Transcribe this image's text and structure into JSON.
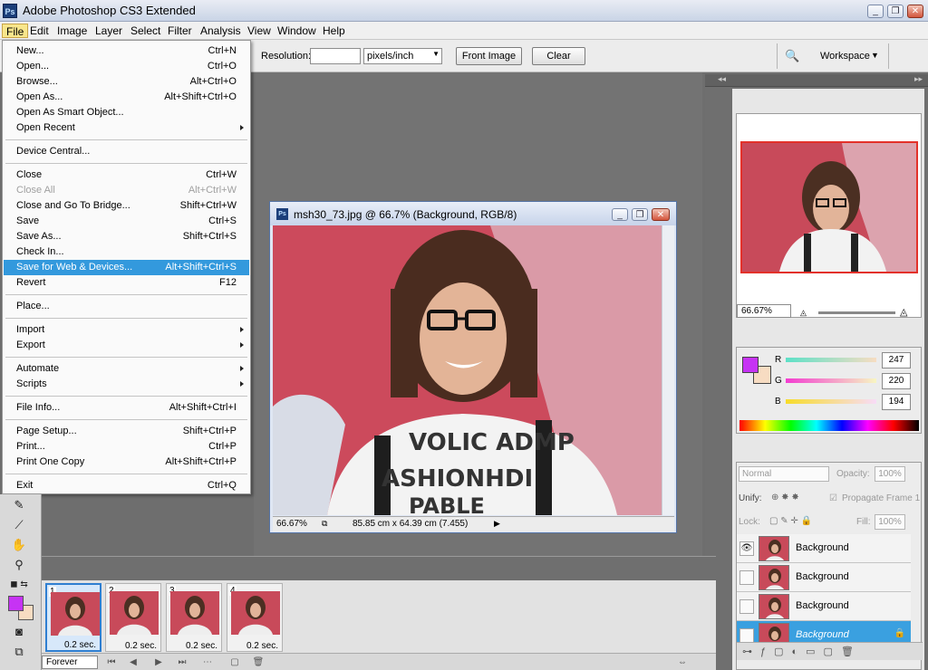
{
  "app": {
    "title": "Adobe Photoshop CS3 Extended",
    "logo": "Ps",
    "window_controls": {
      "minimize": "_",
      "restore": "❐",
      "close": "✕"
    }
  },
  "menubar": [
    "File",
    "Edit",
    "Image",
    "Layer",
    "Select",
    "Filter",
    "Analysis",
    "View",
    "Window",
    "Help"
  ],
  "options_bar": {
    "resolution_label": "Resolution:",
    "resolution_value": "",
    "units_value": "pixels/inch",
    "front_image_label": "Front Image",
    "clear_label": "Clear",
    "workspace_label": "Workspace"
  },
  "file_menu": [
    {
      "label": "New...",
      "shortcut": "Ctrl+N"
    },
    {
      "label": "Open...",
      "shortcut": "Ctrl+O"
    },
    {
      "label": "Browse...",
      "shortcut": "Alt+Ctrl+O"
    },
    {
      "label": "Open As...",
      "shortcut": "Alt+Shift+Ctrl+O"
    },
    {
      "label": "Open As Smart Object...",
      "shortcut": ""
    },
    {
      "label": "Open Recent",
      "shortcut": "",
      "submenu": true
    },
    {
      "divider": true
    },
    {
      "label": "Device Central...",
      "shortcut": ""
    },
    {
      "divider": true
    },
    {
      "label": "Close",
      "shortcut": "Ctrl+W"
    },
    {
      "label": "Close All",
      "shortcut": "Alt+Ctrl+W",
      "disabled": true
    },
    {
      "label": "Close and Go To Bridge...",
      "shortcut": "Shift+Ctrl+W"
    },
    {
      "label": "Save",
      "shortcut": "Ctrl+S"
    },
    {
      "label": "Save As...",
      "shortcut": "Shift+Ctrl+S"
    },
    {
      "label": "Check In...",
      "shortcut": ""
    },
    {
      "label": "Save for Web & Devices...",
      "shortcut": "Alt+Shift+Ctrl+S",
      "highlight": true
    },
    {
      "label": "Revert",
      "shortcut": "F12"
    },
    {
      "divider": true
    },
    {
      "label": "Place...",
      "shortcut": ""
    },
    {
      "divider": true
    },
    {
      "label": "Import",
      "shortcut": "",
      "submenu": true
    },
    {
      "label": "Export",
      "shortcut": "",
      "submenu": true
    },
    {
      "divider": true
    },
    {
      "label": "Automate",
      "shortcut": "",
      "submenu": true
    },
    {
      "label": "Scripts",
      "shortcut": "",
      "submenu": true
    },
    {
      "divider": true
    },
    {
      "label": "File Info...",
      "shortcut": "Alt+Shift+Ctrl+I"
    },
    {
      "divider": true
    },
    {
      "label": "Page Setup...",
      "shortcut": "Shift+Ctrl+P"
    },
    {
      "label": "Print...",
      "shortcut": "Ctrl+P"
    },
    {
      "label": "Print One Copy",
      "shortcut": "Alt+Shift+Ctrl+P"
    },
    {
      "divider": true
    },
    {
      "label": "Exit",
      "shortcut": "Ctrl+Q"
    }
  ],
  "document": {
    "title": "msh30_73.jpg @ 66.7% (Background, RGB/8)",
    "zoom": "66.67%",
    "status_info": "85.85 cm x 64.39 cm (7.455)",
    "image_text_lines": [
      "VOLIC ADMP",
      "ASHIONHDI",
      "PABLE"
    ]
  },
  "animation": {
    "frames": [
      {
        "num": "1",
        "delay": "0.2 sec."
      },
      {
        "num": "2",
        "delay": "0.2 sec."
      },
      {
        "num": "3",
        "delay": "0.2 sec."
      },
      {
        "num": "4",
        "delay": "0.2 sec."
      }
    ],
    "loop": "Forever"
  },
  "navigator": {
    "zoom": "66.67%"
  },
  "color_panel": {
    "fg_color": "#c633f4",
    "bg_color": "#f7dcc2",
    "channels": [
      {
        "name": "R",
        "value": "247"
      },
      {
        "name": "G",
        "value": "220"
      },
      {
        "name": "B",
        "value": "194"
      }
    ]
  },
  "layers_panel": {
    "blend_mode": "Normal",
    "opacity_label": "Opacity:",
    "opacity_value": "100%",
    "unify_label": "Unify:",
    "propagate_label": "Propagate Frame 1",
    "lock_label": "Lock:",
    "fill_label": "Fill:",
    "fill_value": "100%",
    "layers": [
      {
        "name": "Background",
        "visible": true
      },
      {
        "name": "Background",
        "visible": false
      },
      {
        "name": "Background",
        "visible": false
      },
      {
        "name": "Background",
        "visible": false,
        "selected": true
      }
    ]
  }
}
